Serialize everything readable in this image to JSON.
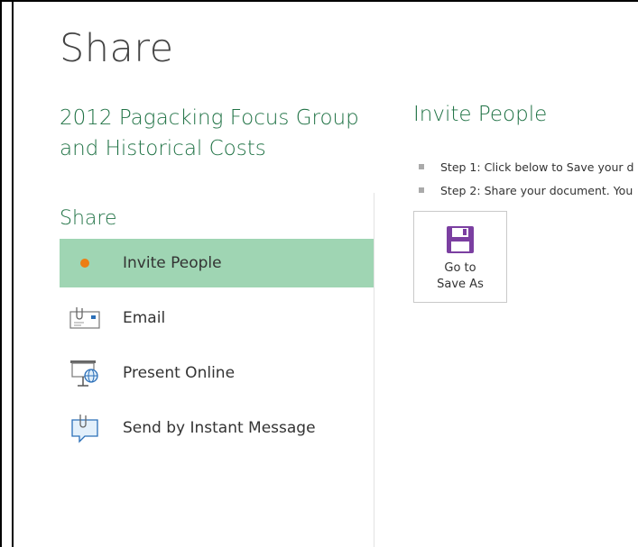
{
  "header": {
    "title": "Share"
  },
  "document": {
    "title": "2012 Pagacking Focus Group and Historical Costs"
  },
  "share_panel": {
    "heading": "Share",
    "items": [
      {
        "label": "Invite People",
        "icon": "orange-dot-icon",
        "selected": true
      },
      {
        "label": "Email",
        "icon": "email-icon",
        "selected": false
      },
      {
        "label": "Present Online",
        "icon": "present-online-icon",
        "selected": false
      },
      {
        "label": "Send by Instant Message",
        "icon": "instant-message-icon",
        "selected": false
      }
    ]
  },
  "invite_panel": {
    "heading": "Invite People",
    "steps": [
      "Step 1: Click below to Save your d",
      "Step 2: Share your document. You"
    ],
    "save_button": {
      "line1": "Go to",
      "line2": "Save As",
      "icon": "floppy-disk-icon"
    }
  },
  "colors": {
    "accent": "#217346",
    "selected_bg": "#9fd5b3",
    "dot": "#ed7d12",
    "save_icon": "#7b3fa1"
  }
}
